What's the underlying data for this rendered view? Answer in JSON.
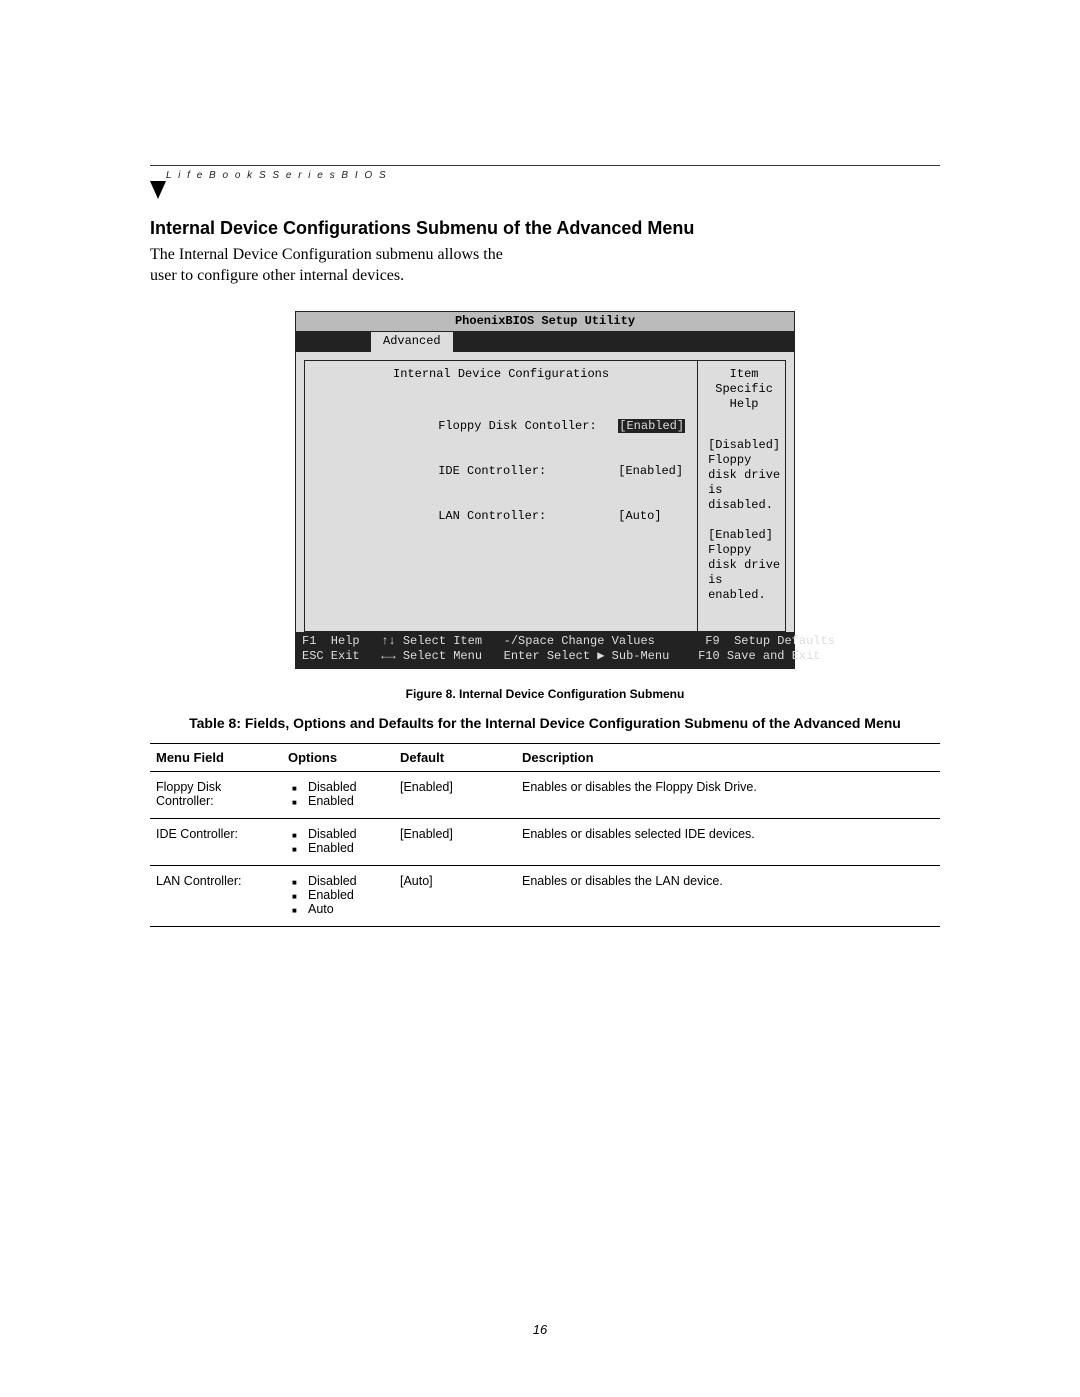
{
  "header": {
    "breadcrumb": "L i f e B o o k   S   S e r i e s   B I O S"
  },
  "section_title": "Internal Device Configurations Submenu of the Advanced Menu",
  "intro_line1": "The Internal Device Configuration submenu allows the",
  "intro_line2": "user to configure other internal devices.",
  "bios": {
    "title": "PhoenixBIOS Setup Utility",
    "active_tab": "Advanced",
    "left_panel_title": "Internal Device Configurations",
    "right_panel_title": "Item Specific Help",
    "fields": {
      "floppy_label": "Floppy Disk Contoller:",
      "floppy_value": "[Enabled]",
      "ide_label": "IDE Controller:",
      "ide_value": "[Enabled]",
      "lan_label": "LAN Controller:",
      "lan_value": "[Auto]"
    },
    "help": {
      "l1": "[Disabled]",
      "l2": "Floppy disk drive is",
      "l3": "disabled.",
      "l4": "[Enabled]",
      "l5": "Floppy disk drive is",
      "l6": "enabled."
    },
    "footer": {
      "row1": "F1  Help   ↑↓ Select Item   -/Space Change Values       F9  Setup Defaults",
      "row2": "ESC Exit   ←→ Select Menu   Enter Select ▶ Sub-Menu    F10 Save and Exit"
    }
  },
  "figure_caption": "Figure 8.  Internal Device Configuration Submenu",
  "table_title": "Table 8: Fields, Options and Defaults for the Internal Device Configuration Submenu of the Advanced Menu",
  "table": {
    "headers": {
      "c1": "Menu Field",
      "c2": "Options",
      "c3": "Default",
      "c4": "Description"
    },
    "rows": [
      {
        "menu_field": "Floppy Disk Controller:",
        "options": [
          "Disabled",
          "Enabled"
        ],
        "default": "[Enabled]",
        "description": "Enables or disables the Floppy Disk Drive."
      },
      {
        "menu_field": "IDE Controller:",
        "options": [
          "Disabled",
          "Enabled"
        ],
        "default": "[Enabled]",
        "description": "Enables or disables selected IDE devices."
      },
      {
        "menu_field": "LAN Controller:",
        "options": [
          "Disabled",
          "Enabled",
          "Auto"
        ],
        "default": "[Auto]",
        "description": "Enables or disables the LAN device."
      }
    ]
  },
  "page_number": "16"
}
